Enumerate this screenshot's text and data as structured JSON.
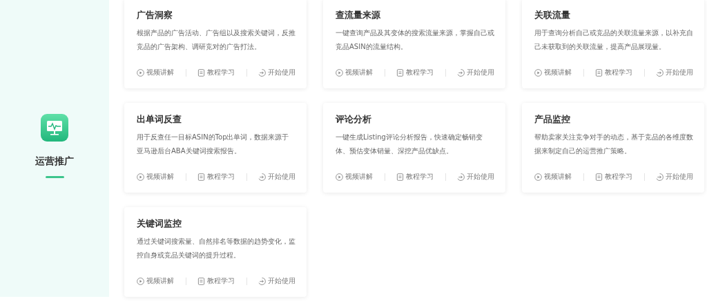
{
  "section": {
    "title": "运营推广"
  },
  "cards": [
    {
      "title": "广告洞察",
      "description": "根据产品的广告活动、广告组以及搜索关键词，反推竞品的广告架构、调研竞对的广告打法。",
      "actions": [
        {
          "kind": "video",
          "label": "视频讲解"
        },
        {
          "kind": "tutorial",
          "label": "教程学习"
        },
        {
          "kind": "start",
          "label": "开始使用"
        }
      ]
    },
    {
      "title": "查流量来源",
      "description": "一键查询产品及其变体的搜索流量来源，掌握自己或竞品ASIN的流量结构。",
      "actions": [
        {
          "kind": "video",
          "label": "视频讲解"
        },
        {
          "kind": "tutorial",
          "label": "教程学习"
        },
        {
          "kind": "start",
          "label": "开始使用"
        }
      ]
    },
    {
      "title": "关联流量",
      "description": "用于查询分析自己或竞品的关联流量来源，以补充自己未获取到的关联流量，提高产品展现量。",
      "actions": [
        {
          "kind": "video",
          "label": "视频讲解"
        },
        {
          "kind": "tutorial",
          "label": "教程学习"
        },
        {
          "kind": "start",
          "label": "开始使用"
        }
      ]
    },
    {
      "title": "出单词反查",
      "description": "用于反查任一目标ASIN的Top出单词，数据来源于亚马逊后台ABA关键词搜索报告。",
      "actions": [
        {
          "kind": "video",
          "label": "视频讲解"
        },
        {
          "kind": "tutorial",
          "label": "教程学习"
        },
        {
          "kind": "start",
          "label": "开始使用"
        }
      ]
    },
    {
      "title": "评论分析",
      "description": "一键生成Listing评论分析报告，快速确定畅销变体、预估变体销量、深挖产品优缺点。",
      "actions": [
        {
          "kind": "video",
          "label": "视频讲解"
        },
        {
          "kind": "tutorial",
          "label": "教程学习"
        },
        {
          "kind": "start",
          "label": "开始使用"
        }
      ]
    },
    {
      "title": "产品监控",
      "description": "帮助卖家关注竞争对手的动态，基于竞品的各维度数据来制定自己的运营推广策略。",
      "actions": [
        {
          "kind": "video",
          "label": "视频讲解"
        },
        {
          "kind": "tutorial",
          "label": "教程学习"
        },
        {
          "kind": "start",
          "label": "开始使用"
        }
      ]
    },
    {
      "title": "关键词监控",
      "description": "通过关键词搜索量、自然排名等数据的趋势变化，监控自身或竞品关键词的提升过程。",
      "actions": [
        {
          "kind": "video",
          "label": "视频讲解"
        },
        {
          "kind": "tutorial",
          "label": "教程学习"
        },
        {
          "kind": "start",
          "label": "开始使用"
        }
      ]
    }
  ]
}
